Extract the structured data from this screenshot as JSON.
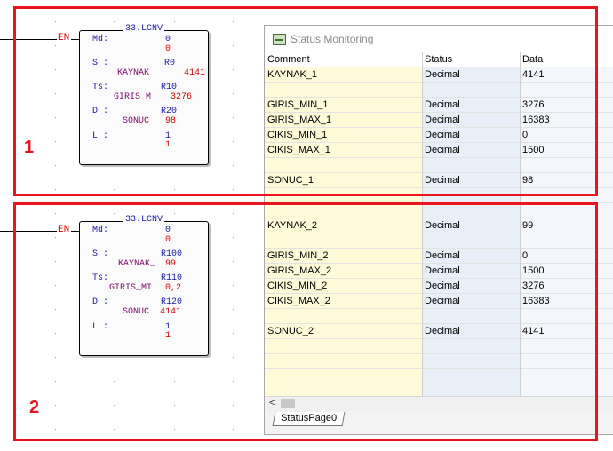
{
  "colors": {
    "annotation_red": "#e8141e",
    "comment_bg": "#fffbd9",
    "status_bg": "#e9eff8",
    "block_text": "#1a1aa0",
    "value_red": "#d00000"
  },
  "annotations": {
    "frame1_number": "1",
    "frame2_number": "2"
  },
  "ladder": {
    "blocks": [
      {
        "en": "EN",
        "title": "33.LCNV",
        "md_label": "Md:",
        "md_value": "0",
        "md_current": "0",
        "s_label": "S :",
        "s_value": "R0",
        "s_name": "KAYNAK",
        "s_current": "4141",
        "ts_label": "Ts:",
        "ts_value": "R10",
        "ts_name": "GIRIS_M",
        "ts_current": "3276",
        "d_label": "D :",
        "d_value": "R20",
        "d_name": "SONUC_",
        "d_current": "98",
        "l_label": "L :",
        "l_value": "1",
        "l_current": "1"
      },
      {
        "en": "EN",
        "title": "33.LCNV",
        "md_label": "Md:",
        "md_value": "0",
        "md_current": "0",
        "s_label": "S :",
        "s_value": "R100",
        "s_name": "KAYNAK_",
        "s_current": "99",
        "ts_label": "Ts:",
        "ts_value": "R110",
        "ts_name": "GIRIS_MI",
        "ts_current": "0,2",
        "d_label": "D :",
        "d_value": "R120",
        "d_name": "SONUC",
        "d_current": "4141",
        "l_label": "L :",
        "l_value": "1",
        "l_current": "1"
      }
    ]
  },
  "status_window": {
    "title": "Status Monitoring",
    "icon": "monitor-icon",
    "columns": [
      "Comment",
      "Status",
      "Data"
    ],
    "rows": [
      {
        "comment": "KAYNAK_1",
        "status": "Decimal",
        "data": "4141"
      },
      {
        "comment": "",
        "status": "",
        "data": ""
      },
      {
        "comment": "GIRIS_MIN_1",
        "status": "Decimal",
        "data": "3276"
      },
      {
        "comment": "GIRIS_MAX_1",
        "status": "Decimal",
        "data": "16383"
      },
      {
        "comment": "CIKIS_MIN_1",
        "status": "Decimal",
        "data": "0"
      },
      {
        "comment": "CIKIS_MAX_1",
        "status": "Decimal",
        "data": "1500"
      },
      {
        "comment": "",
        "status": "",
        "data": ""
      },
      {
        "comment": "SONUC_1",
        "status": "Decimal",
        "data": "98"
      },
      {
        "comment": "",
        "status": "",
        "data": ""
      },
      {
        "comment": "",
        "status": "",
        "data": ""
      },
      {
        "comment": "KAYNAK_2",
        "status": "Decimal",
        "data": "99"
      },
      {
        "comment": "",
        "status": "",
        "data": ""
      },
      {
        "comment": "GIRIS_MIN_2",
        "status": "Decimal",
        "data": "0"
      },
      {
        "comment": "GIRIS_MAX_2",
        "status": "Decimal",
        "data": "1500"
      },
      {
        "comment": "CIKIS_MIN_2",
        "status": "Decimal",
        "data": "3276"
      },
      {
        "comment": "CIKIS_MAX_2",
        "status": "Decimal",
        "data": "16383"
      },
      {
        "comment": "",
        "status": "",
        "data": ""
      },
      {
        "comment": "SONUC_2",
        "status": "Decimal",
        "data": "4141"
      },
      {
        "comment": "",
        "status": "",
        "data": ""
      },
      {
        "comment": "",
        "status": "",
        "data": ""
      },
      {
        "comment": "",
        "status": "",
        "data": ""
      },
      {
        "comment": "",
        "status": "",
        "data": ""
      },
      {
        "comment": "",
        "status": "",
        "data": ""
      }
    ],
    "scroll_left_arrow": "<",
    "tab_label": "StatusPage0"
  }
}
